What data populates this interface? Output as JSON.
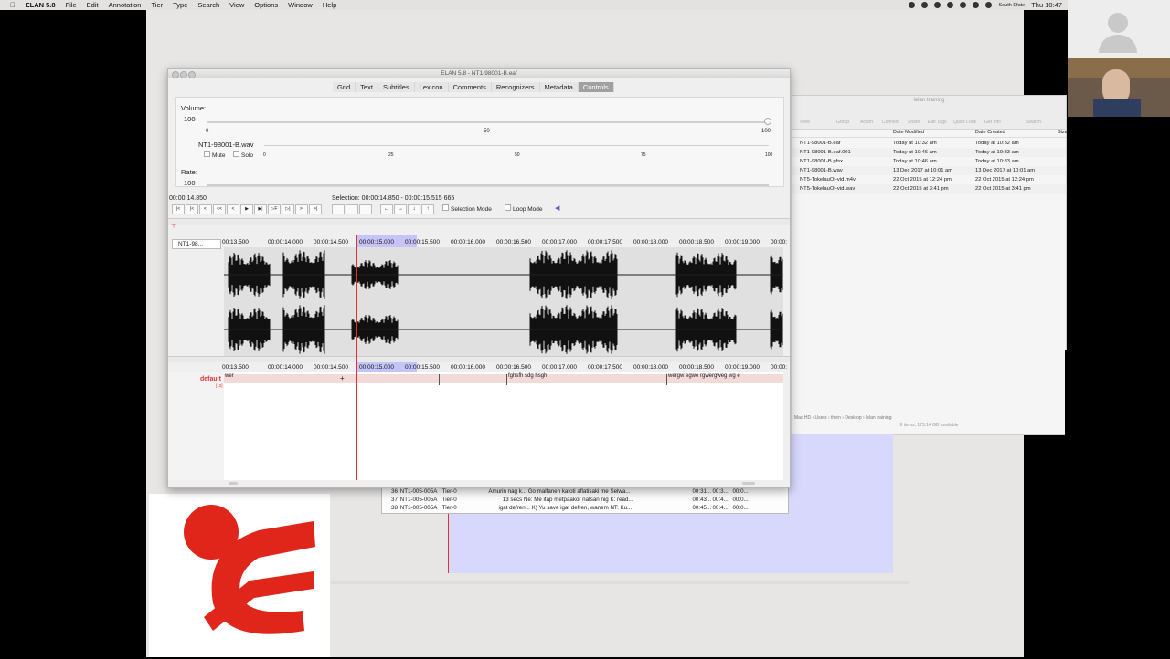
{
  "menubar": {
    "items": [
      "ELAN 5.8",
      "File",
      "Edit",
      "Annotation",
      "Tier",
      "Type",
      "Search",
      "View",
      "Options",
      "Window",
      "Help"
    ],
    "location": "South Efate",
    "clock": "Thu 10:47"
  },
  "window": {
    "title": "ELAN 5.8 - NT1-98001-B.eaf"
  },
  "tabs": [
    "Grid",
    "Text",
    "Subtitles",
    "Lexicon",
    "Comments",
    "Recognizers",
    "Metadata",
    "Controls"
  ],
  "controls": {
    "volume_label": "Volume:",
    "volume_value": "100",
    "volume_scale": [
      "0",
      "50",
      "100"
    ],
    "media_name": "NT1-98001-B.wav",
    "mute": "Mute",
    "solo": "Solo",
    "media_scale": [
      "0",
      "25",
      "50",
      "75",
      "100"
    ],
    "rate_label": "Rate:",
    "rate_value": "100"
  },
  "player": {
    "time": "00:00:14.850",
    "selection": "Selection: 00:00:14.850 - 00:00:15.515  665",
    "selection_mode": "Selection Mode",
    "loop_mode": "Loop Mode",
    "buttons": [
      "|<",
      "|<",
      "<|",
      "<<",
      "<",
      "▶",
      "▶|",
      "▷F",
      "▷|",
      ">|",
      " >|"
    ]
  },
  "timeline": {
    "track_name": "NT1-98...",
    "ticks": [
      "00:13.500",
      "00:00:14.000",
      "00:00:14.500",
      "00:00:15.000",
      "00:00:15.500",
      "00:00:16.000",
      "00:00:16.500",
      "00:00:17.000",
      "00:00:17.500",
      "00:00:18.000",
      "00:00:18.500",
      "00:00:19.000",
      "00:00:"
    ]
  },
  "annotation": {
    "tier": "default",
    "tier_count": "[12]",
    "ann1": "wer",
    "ann2": "fghsfh sdg hsgh",
    "ann3": "wergw egwe rgwergweg wg e",
    "ticks": [
      "00:13.500",
      "00:00:14.000",
      "00:00:14.500",
      "00:00:15.000",
      "00:00:15.500",
      "00:00:16.000",
      "00:00:16.500",
      "00:00:17.000",
      "00:00:17.500",
      "00:00:18.000",
      "00:00:18.500",
      "00:00:19.000",
      "00:00:"
    ]
  },
  "finder": {
    "title": "lelan training",
    "toolbar": [
      "View",
      "Group",
      "Action",
      "Connect",
      "Share",
      "Edit Tags",
      "Quick Look",
      "Get Info",
      "Search"
    ],
    "headers": [
      "Date Modified",
      "Date Created",
      "Size"
    ],
    "rows": [
      {
        "name": "NT1-98001-B.eaf",
        "mod": "Today at 10:32 am",
        "created": "Today at 10:32 am"
      },
      {
        "name": "NT1-98001-B.eaf.001",
        "mod": "Today at 10:46 am",
        "created": "Today at 10:33 am"
      },
      {
        "name": "NT1-98001-B.pfsx",
        "mod": "Today at 10:46 am",
        "created": "Today at 10:33 am"
      },
      {
        "name": "NT1-98001-B.wav",
        "mod": "13 Dec 2017 at 10:01 am",
        "created": "13 Dec 2017 at 10:01 am"
      },
      {
        "name": "NT5-TokelauOf-vid.m4v",
        "mod": "22 Oct 2015 at 12:24 pm",
        "created": "22 Oct 2015 at 12:24 pm"
      },
      {
        "name": "NT5-TokelauOf-vid.wav",
        "mod": "22 Oct 2015 at 3:41 pm",
        "created": "22 Oct 2015 at 3:41 pm"
      }
    ],
    "path": [
      "Mac HD",
      "Users",
      "thien",
      "Desktop",
      "lelan training"
    ],
    "status": "6 items, 173.14 GB available"
  },
  "list": {
    "rows": [
      {
        "n": "36",
        "file": "NT1-005-005A",
        "tier": "Tier-0",
        "text": "Amurin nag k... Go malfanen kafoti aflatisaki me",
        "right": "Selwa...",
        "t1": "00:31...",
        "t2": "00:3...",
        "t3": "00:0..."
      },
      {
        "n": "37",
        "file": "NT1-005-005A",
        "tier": "Tier-0",
        "text": "13 secs  Ne: Me itap metpaakor nafsan nig",
        "right": "K: read...",
        "t1": "00:43...",
        "t2": "00:4...",
        "t3": "00:0..."
      },
      {
        "n": "38",
        "file": "NT1-005-005A",
        "tier": "Tier-0",
        "text": "igat defren...  K) Yu save igat defren, wanem",
        "right": "NT: Ku...",
        "t1": "00:45...",
        "t2": "00:4...",
        "t3": "00:0..."
      }
    ]
  }
}
